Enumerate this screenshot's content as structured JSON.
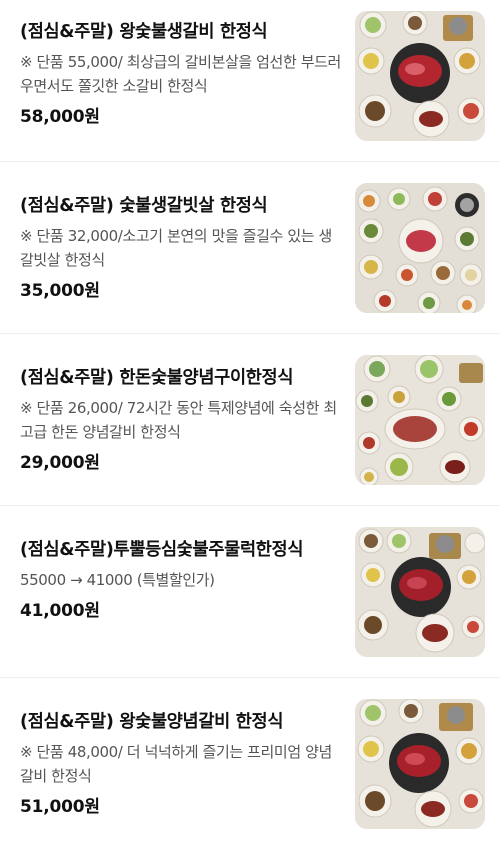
{
  "menu_items": [
    {
      "title": "(점심&주말) 왕숯불생갈비 한정식",
      "description": "※ 단품 55,000/ 최상급의 갈비본살을 엄선한 부드러우면서도 쫄깃한 소갈비 한정식",
      "price": "58,000원",
      "image_icon": "korean-set-meal-photo"
    },
    {
      "title": "(점심&주말) 숯불생갈빗살 한정식",
      "description": "※ 단품 32,000/소고기 본연의 맛을 즐길수 있는 생갈빗살 한정식",
      "price": "35,000원",
      "image_icon": "korean-set-meal-photo"
    },
    {
      "title": "(점심&주말) 한돈숯불양념구이한정식",
      "description": "※ 단품 26,000/ 72시간 동안 특제양념에 숙성한 최고급 한돈 양념갈비 한정식",
      "price": "29,000원",
      "image_icon": "korean-set-meal-photo"
    },
    {
      "title": "(점심&주말)투뿔등심숯불주물럭한정식",
      "description": "55000 → 41000 (특별할인가)",
      "price": "41,000원",
      "image_icon": "korean-set-meal-photo"
    },
    {
      "title": "(점심&주말) 왕숯불양념갈비 한정식",
      "description": "※ 단품 48,000/ 더 넉넉하게 즐기는 프리미엄 양념갈비 한정식",
      "price": "51,000원",
      "image_icon": "korean-set-meal-photo"
    }
  ]
}
